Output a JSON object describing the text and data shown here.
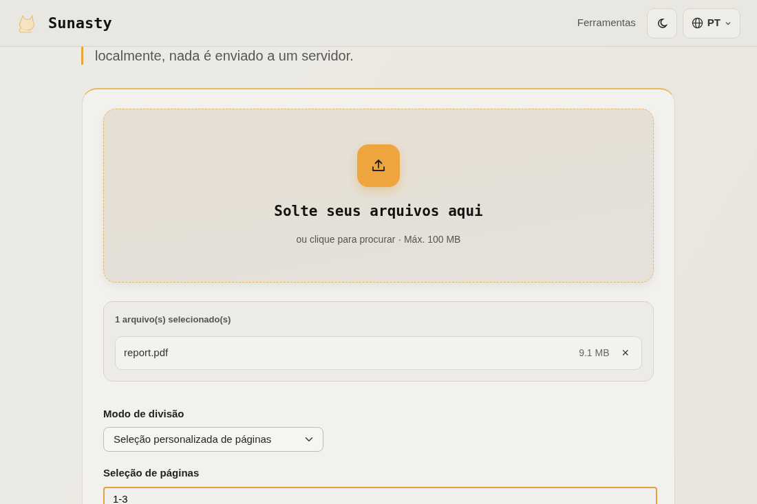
{
  "header": {
    "brand": "Sunasty",
    "nav_link": "Ferramentas",
    "language": "PT"
  },
  "intro": {
    "text": "localmente, nada é enviado a um servidor."
  },
  "dropzone": {
    "title": "Solte seus arquivos aqui",
    "hint": "ou clique para procurar · Máx. 100 MB"
  },
  "files": {
    "heading": "1 arquivo(s) selecionado(s)",
    "items": [
      {
        "name": "report.pdf",
        "size": "9.1 MB",
        "remove": "×"
      }
    ]
  },
  "split_mode": {
    "label": "Modo de divisão",
    "value": "Seleção personalizada de páginas"
  },
  "page_selection": {
    "label": "Seleção de páginas",
    "value": "1-3",
    "focused": true
  }
}
